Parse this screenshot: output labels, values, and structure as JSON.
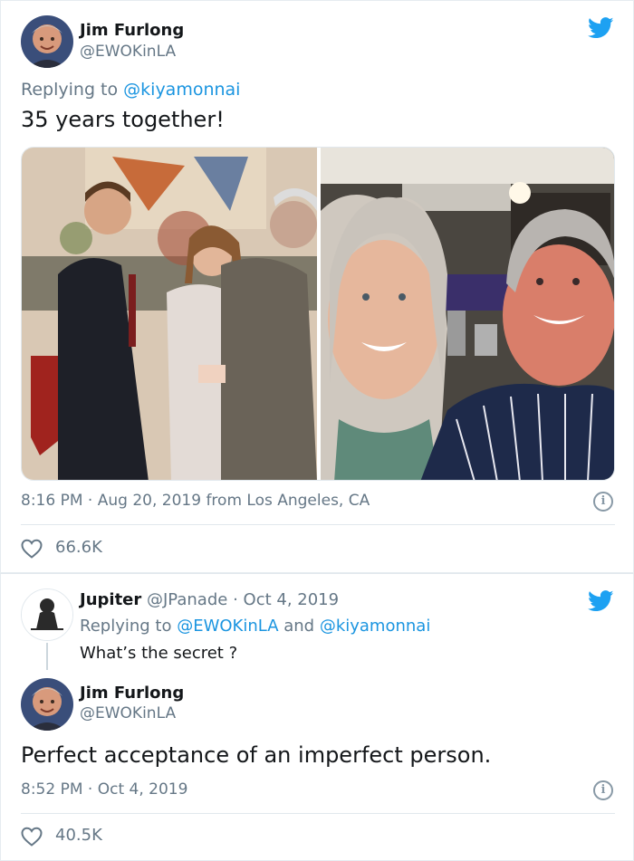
{
  "tweet1": {
    "author_name": "Jim Furlong",
    "author_handle": "@EWOKinLA",
    "replying_prefix": "Replying to ",
    "replying_to": "@kiyamonnai",
    "text": "35 years together!",
    "time": "8:16 PM",
    "date": "Aug 20, 2019",
    "location": "from Los Angeles, CA",
    "likes": "66.6K",
    "photo_icon": "couple-photo-collage"
  },
  "reply": {
    "author_name": "Jupiter",
    "author_handle": "@JPanade",
    "date": "Oct 4, 2019",
    "replying_prefix": "Replying to ",
    "replying_to_1": "@EWOKinLA",
    "and_word": " and ",
    "replying_to_2": "@kiyamonnai",
    "text": "What’s the secret ?"
  },
  "tweet2": {
    "author_name": "Jim Furlong",
    "author_handle": "@EWOKinLA",
    "text": "Perfect acceptance of an imperfect person.",
    "time": "8:52 PM",
    "date": "Oct 4, 2019",
    "likes": "40.5K"
  },
  "colors": {
    "twitter_blue": "#1da1f2",
    "link_blue": "#1b95e0",
    "secondary_text": "#657786",
    "border": "#e1e8ed"
  },
  "separator": "·"
}
